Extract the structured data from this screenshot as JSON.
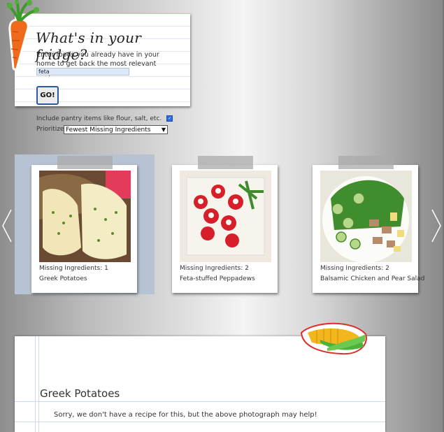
{
  "search": {
    "title": "What's in your fridge?",
    "description": "Enter foods you already have in your home to get back the most relevant recipes:",
    "input_value": "feta",
    "go_label": "GO!"
  },
  "options": {
    "pantry_label": "Include pantry items like flour, salt, etc.",
    "pantry_checked": true,
    "prioritize_label": "Prioritize:",
    "prioritize_value": "Fewest Missing Ingredients"
  },
  "recipes": [
    {
      "missing": "Missing Ingredients: 1",
      "name": "Greek Potatoes",
      "selected": true
    },
    {
      "missing": "Missing Ingredients: 2",
      "name": "Feta-stuffed Peppadews",
      "selected": false
    },
    {
      "missing": "Missing Ingredients: 2",
      "name": "Balsamic Chicken and Pear Salad",
      "selected": false
    }
  ],
  "detail": {
    "title": "Greek Potatoes",
    "message": "Sorry, we don't have a recipe for this, but the above photograph may help!"
  },
  "colors": {
    "selected_bg": "#b7c3d3",
    "go_border": "#2c5aa0",
    "input_bg": "#dde8fb"
  },
  "icons": [
    "carrot-icon",
    "corn-icon",
    "chevron-left-icon",
    "chevron-right-icon"
  ]
}
